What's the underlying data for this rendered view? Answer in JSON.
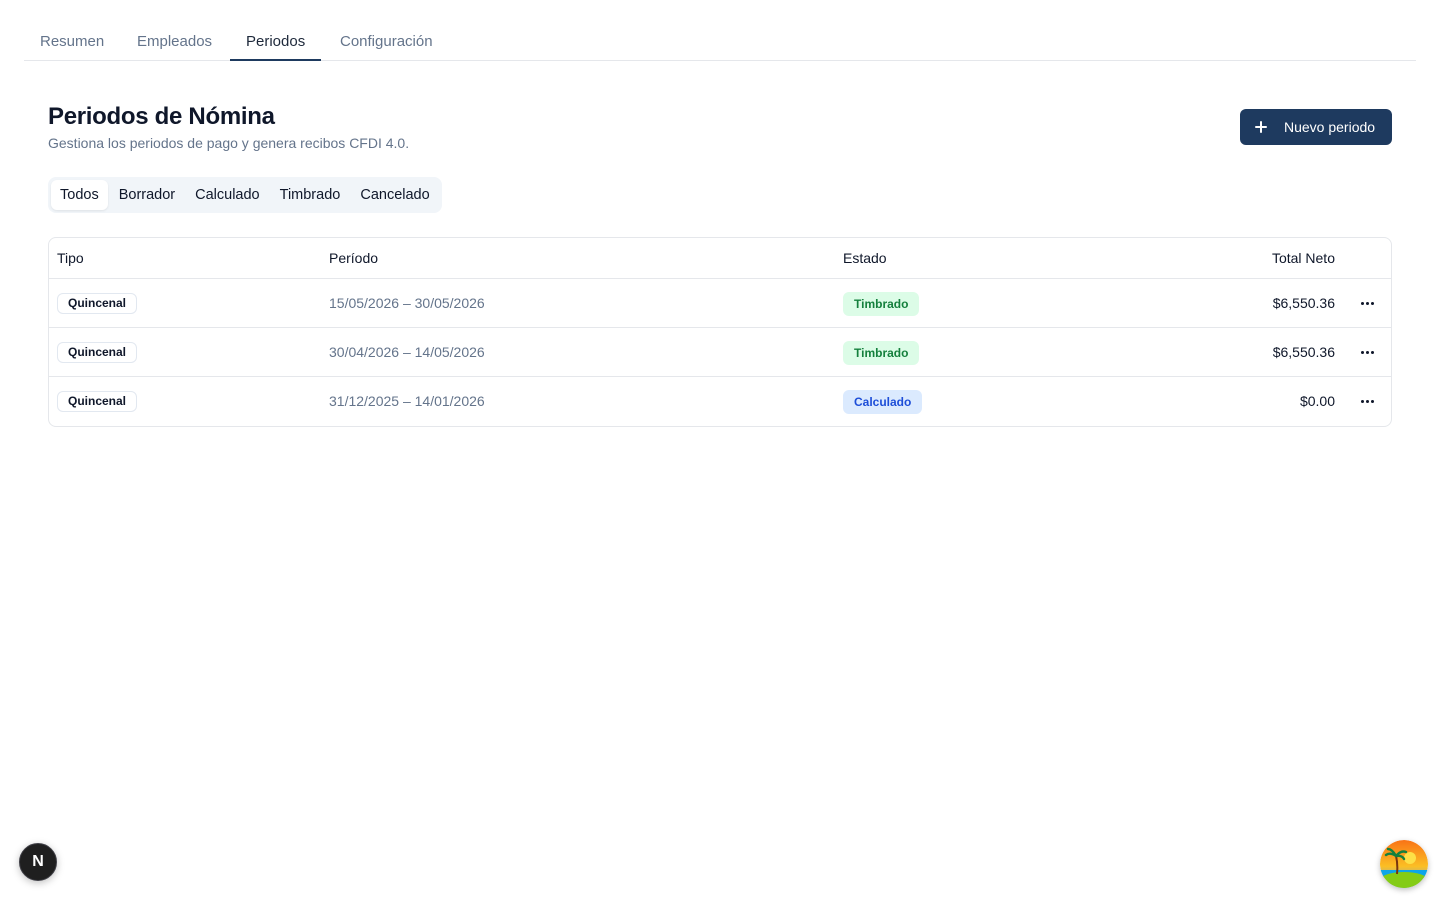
{
  "nav": {
    "tabs": [
      {
        "label": "Resumen"
      },
      {
        "label": "Empleados"
      },
      {
        "label": "Periodos"
      },
      {
        "label": "Configuración"
      }
    ],
    "active": "Periodos"
  },
  "header": {
    "title": "Periodos de Nómina",
    "subtitle": "Gestiona los periodos de pago y genera recibos CFDI 4.0.",
    "new_button_label": "Nuevo periodo",
    "new_button_icon": "plus-icon"
  },
  "filters": {
    "items": [
      {
        "label": "Todos"
      },
      {
        "label": "Borrador"
      },
      {
        "label": "Calculado"
      },
      {
        "label": "Timbrado"
      },
      {
        "label": "Cancelado"
      }
    ],
    "active": "Todos"
  },
  "table": {
    "columns": {
      "tipo": "Tipo",
      "periodo": "Período",
      "estado": "Estado",
      "total": "Total Neto"
    },
    "rows": [
      {
        "tipo": "Quincenal",
        "periodo": "15/05/2026 – 30/05/2026",
        "estado": "Timbrado",
        "total": "$6,550.36"
      },
      {
        "tipo": "Quincenal",
        "periodo": "30/04/2026 – 14/05/2026",
        "estado": "Timbrado",
        "total": "$6,550.36"
      },
      {
        "tipo": "Quincenal",
        "periodo": "31/12/2025 – 14/01/2026",
        "estado": "Calculado",
        "total": "$0.00"
      }
    ]
  },
  "status_colors": {
    "Timbrado": {
      "bg": "#dcfce7",
      "fg": "#15803d"
    },
    "Calculado": {
      "bg": "#dbeafe",
      "fg": "#1d4ed8"
    }
  },
  "brand": {
    "primary": "#1e3a5f"
  },
  "dev_badge": {
    "letter": "N",
    "icon": "nextjs-icon"
  },
  "user": {
    "avatar_icon": "palm-beach-avatar-icon"
  }
}
